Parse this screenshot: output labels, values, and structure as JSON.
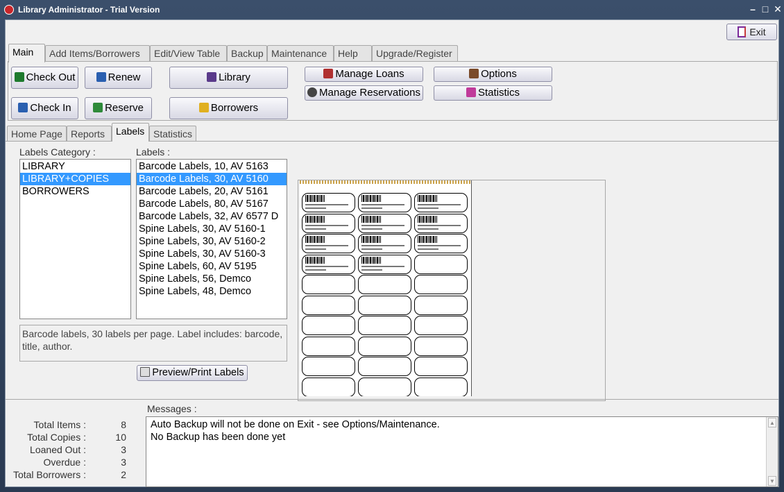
{
  "window": {
    "title": "Library Administrator - Trial Version"
  },
  "toolbar": {
    "exit_label": "Exit"
  },
  "main_tabs": [
    "Main",
    "Add Items/Borrowers",
    "Edit/View Table",
    "Backup",
    "Maintenance",
    "Help",
    "Upgrade/Register"
  ],
  "actions": {
    "check_out": "Check Out",
    "renew": "Renew",
    "library": "Library",
    "check_in": "Check In",
    "reserve": "Reserve",
    "borrowers": "Borrowers",
    "manage_loans": "Manage Loans",
    "manage_reservations": "Manage Reservations",
    "options": "Options",
    "statistics": "Statistics"
  },
  "sub_tabs": [
    "Home Page",
    "Reports",
    "Labels",
    "Statistics"
  ],
  "labels_page": {
    "category_label": "Labels Category :",
    "categories": [
      "LIBRARY",
      "LIBRARY+COPIES",
      "BORROWERS"
    ],
    "selected_category": "LIBRARY+COPIES",
    "labels_label": "Labels :",
    "labels": [
      "Barcode Labels, 10, AV 5163",
      "Barcode Labels, 30, AV 5160",
      "Barcode Labels, 20, AV 5161",
      "Barcode Labels, 80, AV 5167",
      "Barcode Labels, 32, AV 6577 D",
      "Spine Labels, 30, AV 5160-1",
      "Spine Labels, 30, AV 5160-2",
      "Spine Labels, 30, AV 5160-3",
      "Spine Labels, 60, AV 5195",
      "Spine Labels, 56, Demco",
      "Spine Labels, 48, Demco"
    ],
    "selected_label": "Barcode Labels, 30, AV 5160",
    "description": "Barcode labels, 30 labels per page. Label includes: barcode, title, author.",
    "preview_button": "Preview/Print Labels"
  },
  "summary": {
    "rows": [
      {
        "key": "Total Items :",
        "value": "8"
      },
      {
        "key": "Total Copies :",
        "value": "10"
      },
      {
        "key": "Loaned Out :",
        "value": "3"
      },
      {
        "key": "Overdue :",
        "value": "3"
      },
      {
        "key": "Total Borrowers :",
        "value": "2"
      }
    ]
  },
  "messages": {
    "label": "Messages :",
    "lines": [
      "Auto Backup will not be done on Exit - see Options/Maintenance.",
      "No Backup has been done yet"
    ]
  },
  "icons": [
    "app-logo-icon",
    "minimize-icon",
    "maximize-icon",
    "close-icon",
    "exit-door-icon",
    "printer-icon"
  ]
}
